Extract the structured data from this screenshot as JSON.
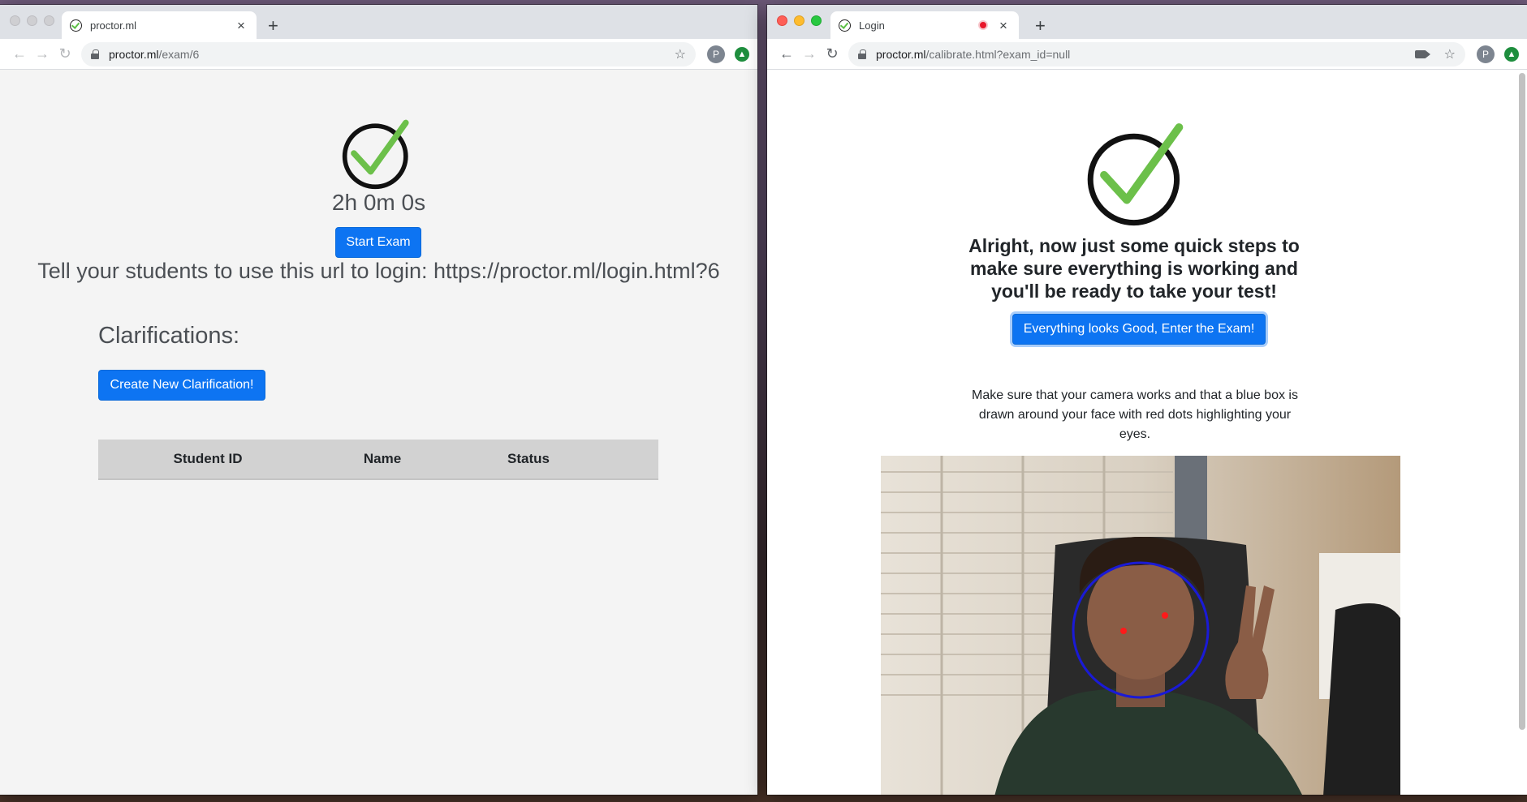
{
  "left_window": {
    "tab": {
      "title": "proctor.ml",
      "close": "×"
    },
    "new_tab": "+",
    "toolbar": {
      "url_host": "proctor.ml",
      "url_path": "/exam/6",
      "avatar_initial": "P"
    },
    "page": {
      "timer": "2h 0m 0s",
      "start_button": "Start Exam",
      "login_url_text": "Tell your students to use this url to login: https://proctor.ml/login.html?6",
      "clarifications_heading": "Clarifications:",
      "create_clarification_button": "Create New Clarification!",
      "table_headers": [
        "Student ID",
        "Name",
        "Status"
      ]
    }
  },
  "right_window": {
    "tab": {
      "title": "Login",
      "close": "×"
    },
    "new_tab": "+",
    "toolbar": {
      "url_host": "proctor.ml",
      "url_path": "/calibrate.html?exam_id=null",
      "avatar_initial": "P"
    },
    "page": {
      "heading": "Alright, now just some quick steps to make sure everything is working and you'll be ready to take your test!",
      "enter_button": "Everything looks Good, Enter the Exam!",
      "instructions": "Make sure that your camera works and that a blue box is drawn around your face with red dots highlighting your eyes."
    }
  },
  "colors": {
    "primary_button": "#0d74f2",
    "check_green": "#6cc04a",
    "face_outline": "#1a1ad6",
    "eye_dot": "#ff1a1a"
  },
  "icons": [
    "back-arrow-icon",
    "forward-arrow-icon",
    "reload-icon",
    "lock-icon",
    "star-icon",
    "camera-icon",
    "extension-icon",
    "check-circle-icon",
    "recording-dot-icon"
  ]
}
